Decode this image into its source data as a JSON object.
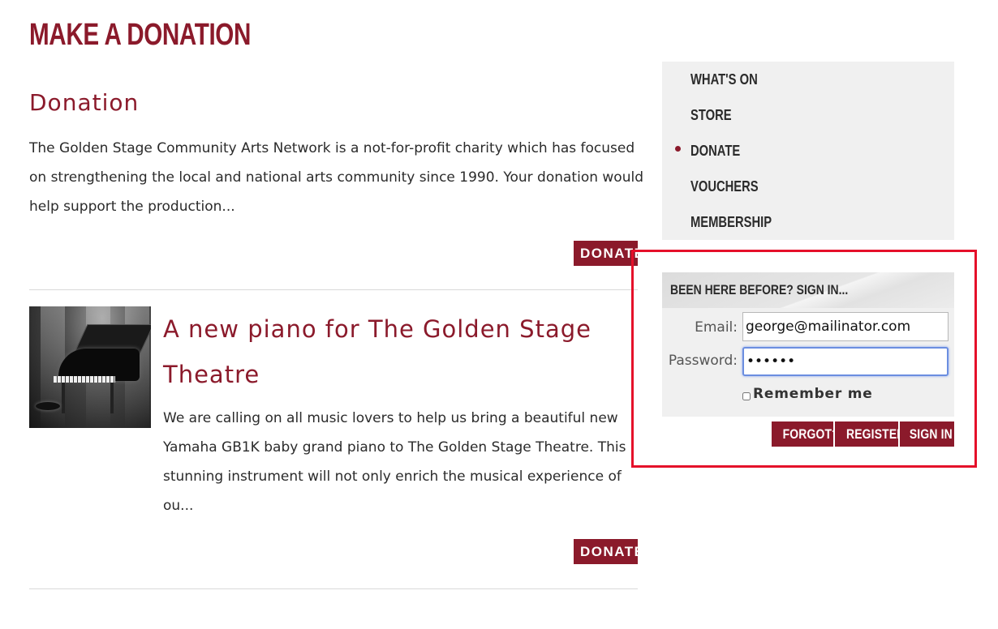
{
  "page": {
    "title": "MAKE A DONATION"
  },
  "donation": {
    "title": "Donation",
    "description": "The Golden Stage Community Arts Network is a not-for-profit charity which has focused on strengthening the local and national arts community since 1990. Your donation would help support the production...",
    "button_label": "DONATE"
  },
  "article": {
    "title": "A new piano for The Golden Stage Theatre",
    "description": "We are calling on all music lovers to help us bring a beautiful new Yamaha GB1K baby grand piano to The Golden Stage Theatre. This stunning instrument will not only enrich the musical experience of ou...",
    "button_label": "DONATE"
  },
  "sidebar": {
    "items": [
      {
        "label": "WHAT'S ON"
      },
      {
        "label": "STORE"
      },
      {
        "label": "DONATE",
        "active": true
      },
      {
        "label": "VOUCHERS"
      },
      {
        "label": "MEMBERSHIP"
      }
    ]
  },
  "signin": {
    "header": "BEEN HERE BEFORE? SIGN IN...",
    "email_label": "Email:",
    "email_value": "george@mailinator.com",
    "password_label": "Password:",
    "password_value": "••••••",
    "remember_label": "Remember me",
    "forgot_label": "FORGOT?",
    "register_label": "REGISTER",
    "signin_label": "SIGN IN"
  },
  "colors": {
    "accent": "#8b1a2b",
    "highlight": "#e5102a",
    "panel": "#f0f0f0"
  }
}
